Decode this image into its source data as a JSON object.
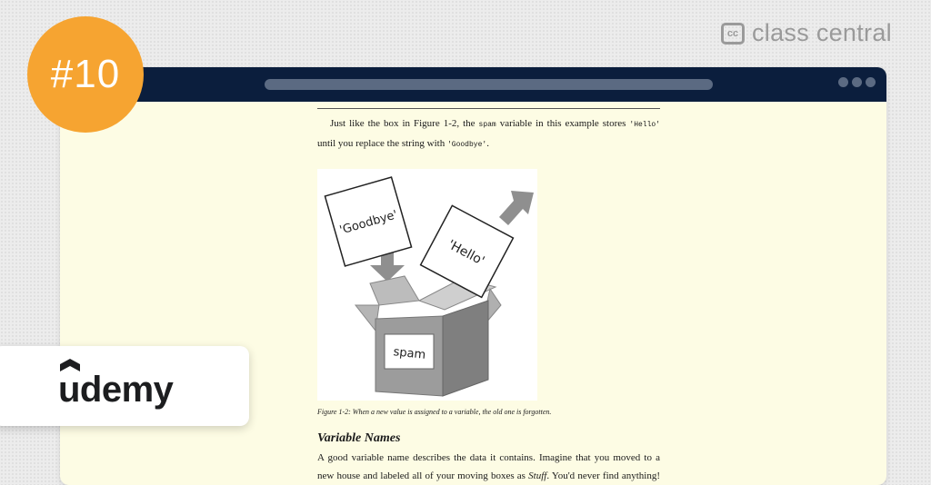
{
  "brand": {
    "icon_text": "cc",
    "name": "class central"
  },
  "badge": {
    "rank": "#10"
  },
  "provider": {
    "name": "udemy"
  },
  "window": {
    "icons": [
      "address-bar",
      "window-dots"
    ]
  },
  "book": {
    "para1": {
      "t1": "Just like the box in Figure 1-2, the ",
      "c1": "spam",
      "t2": " variable in this example stores ",
      "c2": "'Hello'",
      "t3": " until you replace the string with ",
      "c3": "'Goodbye'",
      "t4": "."
    },
    "figure": {
      "card_goodbye": "'Goodbye'",
      "card_hello": "'Hello'",
      "box_label": "spam"
    },
    "caption": "Figure 1-2: When a new value is assigned to a variable, the old one is forgotten.",
    "heading": "Variable Names",
    "para2": {
      "t1": "A good variable name describes the data it contains. Imagine that you moved to a new house and labeled all of your moving boxes as ",
      "em": "Stuff",
      "t2": ". You'd never find anything! Most of"
    }
  },
  "colors": {
    "accent_orange": "#f6a431",
    "titlebar": "#0b1e3d",
    "page_bg": "#fdfce4"
  }
}
